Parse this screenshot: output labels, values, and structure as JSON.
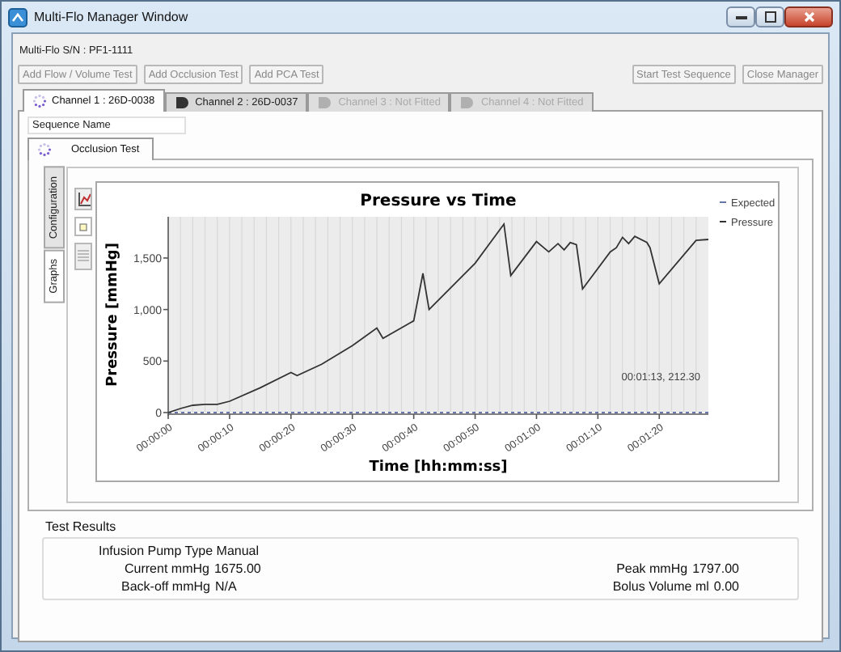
{
  "window": {
    "title": "Multi-Flo Manager Window"
  },
  "serial_label": "Multi-Flo S/N : PF1-1111",
  "toolbar": {
    "left": [
      {
        "label": "Add Flow / Volume Test"
      },
      {
        "label": "Add Occlusion Test"
      },
      {
        "label": "Add PCA Test"
      }
    ],
    "right": [
      {
        "label": "Start Test Sequence"
      },
      {
        "label": "Close Manager"
      }
    ]
  },
  "channel_tabs": [
    {
      "label": "Channel 1 : 26D-0038",
      "kind": "spinner",
      "selected": true,
      "disabled": false
    },
    {
      "label": "Channel 2 : 26D-0037",
      "kind": "plug",
      "selected": false,
      "disabled": false
    },
    {
      "label": "Channel 3 : Not Fitted",
      "kind": "plug",
      "selected": false,
      "disabled": true
    },
    {
      "label": "Channel 4 : Not Fitted",
      "kind": "plug",
      "selected": false,
      "disabled": true
    }
  ],
  "sequence_name": {
    "placeholder": "Sequence Name"
  },
  "test_tabs": [
    {
      "label": "Occlusion Test",
      "selected": true
    }
  ],
  "side_tabs": [
    {
      "label": "Configuration",
      "selected": false
    },
    {
      "label": "Graphs",
      "selected": true
    }
  ],
  "chart": {
    "chart_data": {
      "type": "line",
      "title": "Pressure vs Time",
      "xlabel": "Time [hh:mm:ss]",
      "ylabel": "Pressure [mmHg]",
      "x": [
        0,
        2,
        4,
        6,
        8,
        10,
        15,
        20,
        21,
        25,
        30,
        34,
        35,
        40,
        41.5,
        42.5,
        50,
        54.7,
        55.8,
        60,
        62,
        63.5,
        64.5,
        65.5,
        66.5,
        67.5,
        72,
        73,
        74,
        75,
        76,
        78,
        78.5,
        80,
        86,
        88
      ],
      "series": [
        {
          "name": "Expected",
          "color": "#6677aa",
          "line_style": "dashed",
          "values": [
            0,
            0,
            0,
            0,
            0,
            0,
            0,
            0,
            0,
            0,
            0,
            0,
            0,
            0,
            0,
            0,
            0,
            0,
            0,
            0,
            0,
            0,
            0,
            0,
            0,
            0,
            0,
            0,
            0,
            0,
            0,
            0,
            0,
            0,
            0,
            0
          ]
        },
        {
          "name": "Pressure",
          "color": "#333333",
          "line_style": "solid",
          "values": [
            0,
            40,
            70,
            80,
            80,
            110,
            240,
            390,
            360,
            470,
            650,
            820,
            720,
            890,
            1350,
            1000,
            1450,
            1830,
            1330,
            1660,
            1560,
            1640,
            1580,
            1650,
            1630,
            1200,
            1560,
            1600,
            1700,
            1640,
            1710,
            1650,
            1600,
            1250,
            1670,
            1680
          ]
        }
      ],
      "xlim": [
        0,
        88
      ],
      "ylim": [
        0,
        1900
      ],
      "xticks": [
        {
          "value": 0,
          "label": "00:00:00"
        },
        {
          "value": 10,
          "label": "00:00:10"
        },
        {
          "value": 20,
          "label": "00:00:20"
        },
        {
          "value": 30,
          "label": "00:00:30"
        },
        {
          "value": 40,
          "label": "00:00:40"
        },
        {
          "value": 50,
          "label": "00:00:50"
        },
        {
          "value": 60,
          "label": "00:01:00"
        },
        {
          "value": 70,
          "label": "00:01:10"
        },
        {
          "value": 80,
          "label": "00:01:20"
        }
      ],
      "yticks": [
        {
          "value": 0,
          "label": "0"
        },
        {
          "value": 500,
          "label": "500"
        },
        {
          "value": 1000,
          "label": "1,000"
        },
        {
          "value": 1500,
          "label": "1,500"
        }
      ],
      "grid": true,
      "legend": true,
      "annotations": [
        {
          "text": "00:01:13, 212.30"
        }
      ]
    }
  },
  "results": {
    "title": "Test Results",
    "pump_type": "Infusion Pump Type Manual",
    "fields": [
      {
        "label": "Current mmHg",
        "value": "1675.00"
      },
      {
        "label": "Peak mmHg",
        "value": "1797.00"
      },
      {
        "label": "Back-off mmHg",
        "value": "N/A"
      },
      {
        "label": "Bolus Volume ml",
        "value": "0.00"
      }
    ]
  }
}
